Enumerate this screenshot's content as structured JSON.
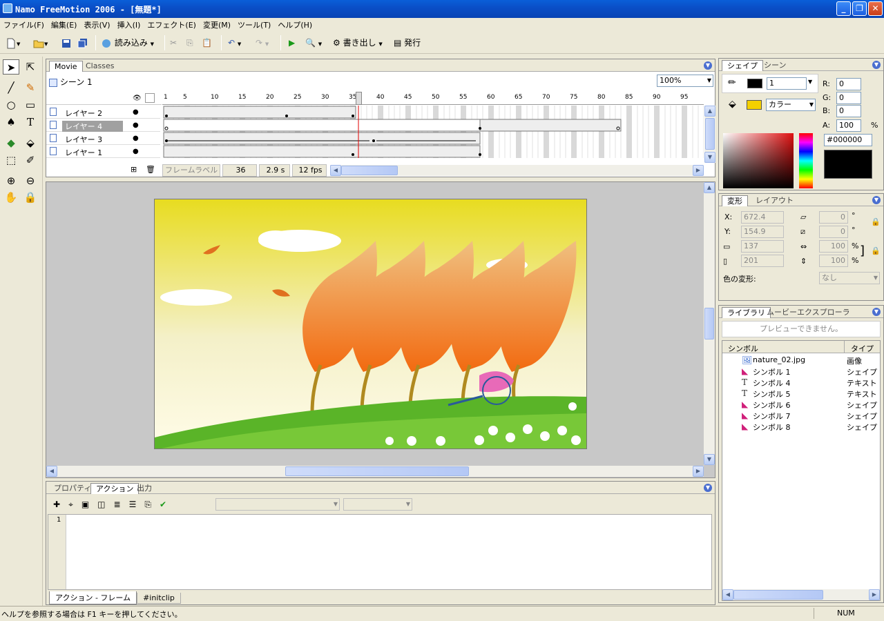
{
  "window": {
    "title": "Namo FreeMotion 2006 - [無題*]"
  },
  "menu": [
    "ファイル(F)",
    "編集(E)",
    "表示(V)",
    "挿入(I)",
    "エフェクト(E)",
    "変更(M)",
    "ツール(T)",
    "ヘルプ(H)"
  ],
  "toolbar": {
    "import_label": "読み込み",
    "export_label": "書き出し",
    "publish_label": "発行"
  },
  "timeline": {
    "tabs": [
      "Movie",
      "Classes"
    ],
    "scene": "シーン 1",
    "zoom": "100%",
    "ruler": [
      "1",
      "5",
      "10",
      "15",
      "20",
      "25",
      "30",
      "35",
      "40",
      "45",
      "50",
      "55",
      "60",
      "65",
      "70",
      "75",
      "80",
      "85",
      "90",
      "95"
    ],
    "layers": [
      "レイヤー 2",
      "レイヤー 4",
      "レイヤー 3",
      "レイヤー 1"
    ],
    "selected_layer": "レイヤー 4",
    "frame_label": "フレームラベル",
    "current_frame": "36",
    "time": "2.9 s",
    "fps": "12 fps"
  },
  "bottom": {
    "tabs": [
      "プロパティ",
      "アクション",
      "出力"
    ],
    "line_number": "1",
    "subtabs": [
      "アクション - フレーム",
      "#initclip"
    ]
  },
  "shape_panel": {
    "tabs": [
      "シェイプ",
      "シーン"
    ],
    "stroke_width": "1",
    "fill_type": "カラー",
    "r_label": "R:",
    "g_label": "G:",
    "b_label": "B:",
    "a_label": "A:",
    "r": "0",
    "g": "0",
    "b": "0",
    "a": "100",
    "hex": "#000000",
    "colors": {
      "stroke": "#000000",
      "fill": "#f4d000"
    }
  },
  "transform_panel": {
    "tabs": [
      "変形",
      "レイアウト"
    ],
    "x_label": "X:",
    "y_label": "Y:",
    "x": "672.4",
    "y": "154.9",
    "w": "137",
    "h": "201",
    "skew1": "0",
    "skew2": "0",
    "scale_w": "100",
    "scale_h": "100",
    "degree": "°",
    "percent": "%",
    "color_label": "色の変形:",
    "color_value": "なし"
  },
  "library": {
    "tabs": [
      "ライブラリ",
      "ムービーエクスプローラ"
    ],
    "preview": "プレビューできません。",
    "col_symbol": "シンボル",
    "col_type": "タイプ",
    "items": [
      {
        "icon": "image-icon",
        "name": "nature_02.jpg",
        "type": "画像"
      },
      {
        "icon": "shape-icon",
        "name": "シンボル 1",
        "type": "シェイプ"
      },
      {
        "icon": "text-icon",
        "name": "シンボル 4",
        "type": "テキスト"
      },
      {
        "icon": "text-icon",
        "name": "シンボル 5",
        "type": "テキスト"
      },
      {
        "icon": "shape-icon",
        "name": "シンボル 6",
        "type": "シェイプ"
      },
      {
        "icon": "shape-icon",
        "name": "シンボル 7",
        "type": "シェイプ"
      },
      {
        "icon": "shape-icon",
        "name": "シンボル 8",
        "type": "シェイプ"
      }
    ]
  },
  "status": {
    "help": "ヘルプを参照する場合は F1 キーを押してください。",
    "num": "NUM"
  }
}
